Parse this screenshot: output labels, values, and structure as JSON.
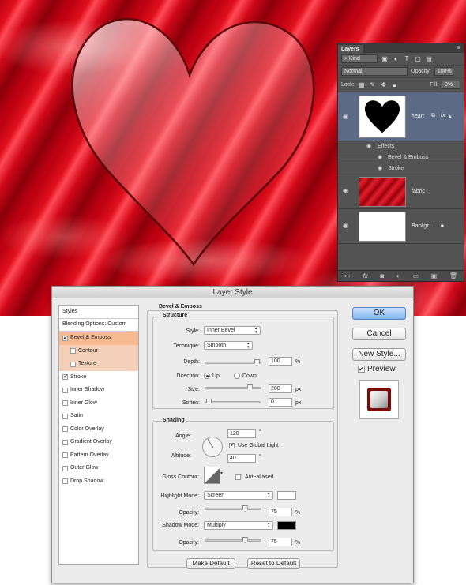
{
  "layers_panel": {
    "tab": "Layers",
    "filter": "Kind",
    "blend_mode": "Normal",
    "opacity_label": "Opacity:",
    "opacity_value": "100%",
    "lock_label": "Lock:",
    "fill_label": "Fill:",
    "fill_value": "0%",
    "layers": [
      {
        "name": "heart",
        "effects_label": "Effects",
        "effects": [
          "Bevel & Emboss",
          "Stroke"
        ]
      },
      {
        "name": "fabric"
      },
      {
        "name": "Backgr..."
      }
    ]
  },
  "dialog": {
    "title": "Layer Style",
    "styles_header": "Styles",
    "style_items": [
      {
        "label": "Blending Options: Custom",
        "checkbox": false,
        "checked": false
      },
      {
        "label": "Bevel & Emboss",
        "checkbox": true,
        "checked": true
      },
      {
        "label": "Contour",
        "checkbox": true,
        "checked": false
      },
      {
        "label": "Texture",
        "checkbox": true,
        "checked": false
      },
      {
        "label": "Stroke",
        "checkbox": true,
        "checked": true
      },
      {
        "label": "Inner Shadow",
        "checkbox": true,
        "checked": false
      },
      {
        "label": "Inner Glow",
        "checkbox": true,
        "checked": false
      },
      {
        "label": "Satin",
        "checkbox": true,
        "checked": false
      },
      {
        "label": "Color Overlay",
        "checkbox": true,
        "checked": false
      },
      {
        "label": "Gradient Overlay",
        "checkbox": true,
        "checked": false
      },
      {
        "label": "Pattern Overlay",
        "checkbox": true,
        "checked": false
      },
      {
        "label": "Outer Glow",
        "checkbox": true,
        "checked": false
      },
      {
        "label": "Drop Shadow",
        "checkbox": true,
        "checked": false
      }
    ],
    "section_title": "Bevel & Emboss",
    "structure": {
      "title": "Structure",
      "style_label": "Style:",
      "style_value": "Inner Bevel",
      "technique_label": "Technique:",
      "technique_value": "Smooth",
      "depth_label": "Depth:",
      "depth_value": "100",
      "depth_unit": "%",
      "depth_level": 1.0,
      "direction_label": "Direction:",
      "direction_up": "Up",
      "direction_down": "Down",
      "size_label": "Size:",
      "size_value": "200",
      "size_unit": "px",
      "size_level": 0.85,
      "soften_label": "Soften:",
      "soften_value": "0",
      "soften_unit": "px",
      "soften_level": 0.0
    },
    "shading": {
      "title": "Shading",
      "angle_label": "Angle:",
      "angle_value": "120",
      "angle_unit": "°",
      "use_global_light": "Use Global Light",
      "altitude_label": "Altitude:",
      "altitude_value": "40",
      "altitude_unit": "°",
      "gloss_label": "Gloss Contour:",
      "anti_aliased": "Anti-aliased",
      "highlight_mode_label": "Highlight Mode:",
      "highlight_mode": "Screen",
      "highlight_color": "#ffffff",
      "opacity_label": "Opacity:",
      "highlight_opacity": "75",
      "opacity_unit": "%",
      "highlight_level": 0.75,
      "shadow_mode_label": "Shadow Mode:",
      "shadow_mode": "Multiply",
      "shadow_color": "#000000",
      "shadow_opacity": "75",
      "shadow_level": 0.75
    },
    "make_default": "Make Default",
    "reset_default": "Reset to Default",
    "ok": "OK",
    "cancel": "Cancel",
    "new_style": "New Style...",
    "preview": "Preview"
  }
}
